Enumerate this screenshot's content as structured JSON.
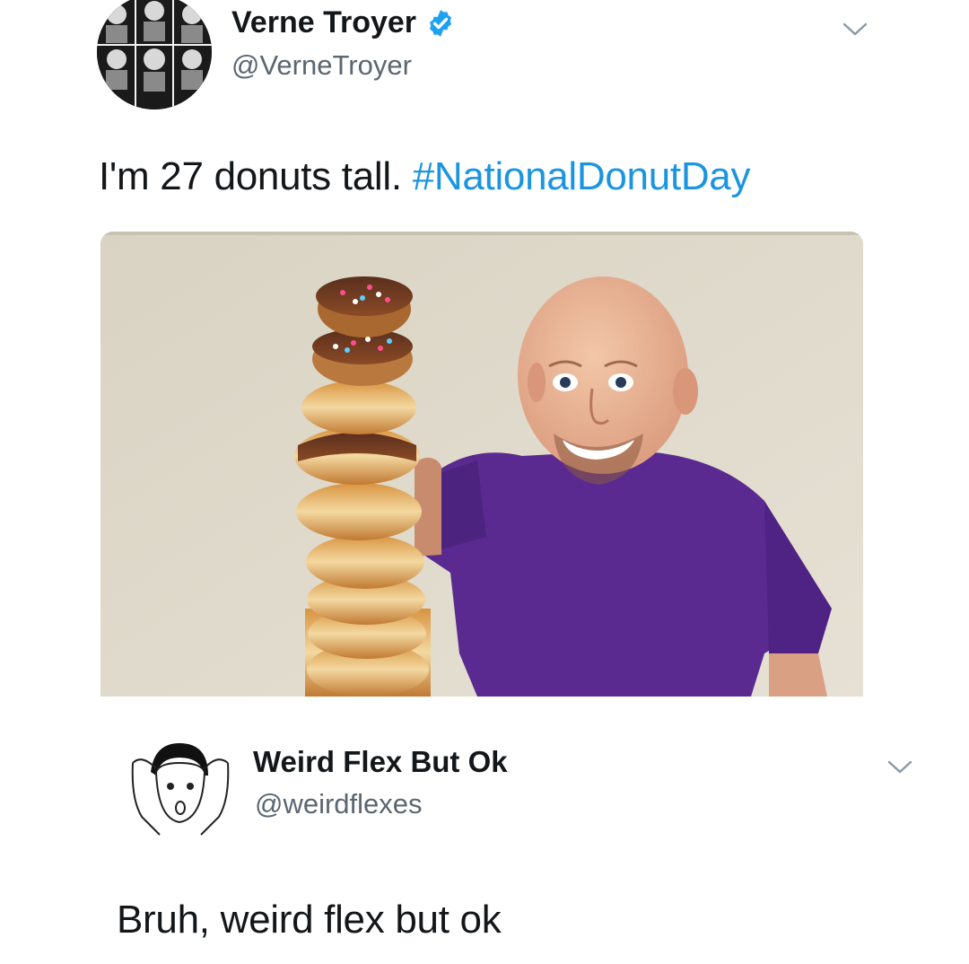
{
  "tweets": [
    {
      "display_name": "Verne Troyer",
      "handle": "@VerneTroyer",
      "verified": true,
      "text_prefix": "I'm 27 donuts tall. ",
      "hashtag": "#NationalDonutDay",
      "avatar_icon": "grid-portrait-avatar",
      "menu_icon": "chevron-down-icon"
    },
    {
      "display_name": "Weird Flex But Ok",
      "handle": "@weirdflexes",
      "verified": false,
      "text": "Bruh, weird flex but ok",
      "avatar_icon": "meme-face-avatar",
      "menu_icon": "chevron-down-icon"
    }
  ],
  "colors": {
    "hashtag": "#1b95e0",
    "verified_badge": "#1da1f2",
    "handle": "#5b6670",
    "shirt": "#5a2a91"
  }
}
